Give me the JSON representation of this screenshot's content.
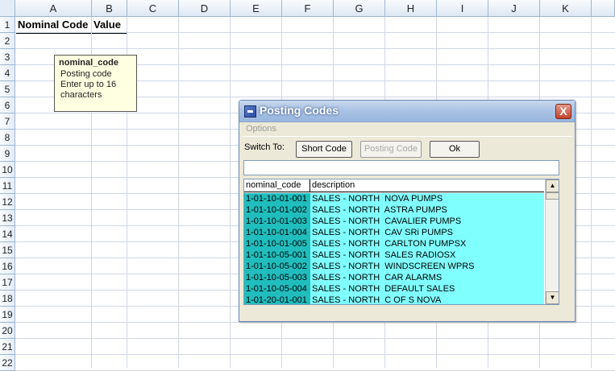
{
  "columns": [
    "A",
    "B",
    "C",
    "D",
    "E",
    "F",
    "G",
    "H",
    "I",
    "J",
    "K"
  ],
  "rows": [
    "1",
    "2",
    "3",
    "4",
    "5",
    "6",
    "7",
    "8",
    "9",
    "10",
    "11",
    "12",
    "13",
    "14",
    "15",
    "16",
    "17",
    "18",
    "19",
    "20",
    "21",
    "22"
  ],
  "cells": {
    "a1": "Nominal Code",
    "b1": "Value"
  },
  "comment": {
    "title": "nominal_code",
    "line1": "Posting code",
    "line2": "Enter up to 16",
    "line3": "characters"
  },
  "dialog": {
    "title": "Posting Codes",
    "close": "X",
    "menu_options": "Options",
    "switch_to_label": "Switch To:",
    "short_code_button": "Short Code",
    "posting_code_button": "Posting Code",
    "ok_button": "Ok",
    "search_value": "",
    "grid": {
      "headers": [
        "nominal_code",
        "description"
      ],
      "rows": [
        {
          "code": "1-01-10-01-001",
          "desc": "SALES - NORTH  NOVA PUMPS"
        },
        {
          "code": "1-01-10-01-002",
          "desc": "SALES - NORTH  ASTRA PUMPS"
        },
        {
          "code": "1-01-10-01-003",
          "desc": "SALES - NORTH  CAVALIER PUMPS"
        },
        {
          "code": "1-01-10-01-004",
          "desc": "SALES - NORTH  CAV SRi PUMPS"
        },
        {
          "code": "1-01-10-01-005",
          "desc": "SALES - NORTH  CARLTON PUMPSX"
        },
        {
          "code": "1-01-10-05-001",
          "desc": "SALES - NORTH  SALES RADIOSX"
        },
        {
          "code": "1-01-10-05-002",
          "desc": "SALES - NORTH  WINDSCREEN WPRS"
        },
        {
          "code": "1-01-10-05-003",
          "desc": "SALES - NORTH  CAR ALARMS"
        },
        {
          "code": "1-01-10-05-004",
          "desc": "SALES - NORTH  DEFAULT SALES"
        },
        {
          "code": "1-01-20-01-001",
          "desc": "SALES - NORTH  C OF S NOVA"
        }
      ]
    }
  },
  "colors": {
    "code_column": "#21bdbd",
    "desc_column": "#80ffff",
    "close_button": "#c3412a"
  },
  "icons": {
    "up": "▲",
    "down": "▼"
  }
}
